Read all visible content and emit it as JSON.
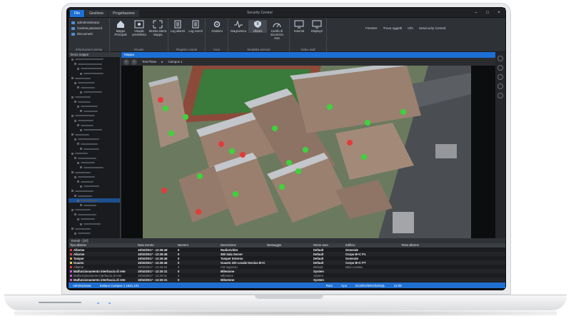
{
  "window": {
    "title": "Security Central",
    "tabs": [
      {
        "label": "File",
        "active": true
      },
      {
        "label": "Gestione",
        "active": false
      },
      {
        "label": "Progettazione",
        "active": false
      }
    ],
    "top_menu": [
      "Finestre",
      "Trova oggetti",
      "Info",
      "Sesecurity Central"
    ]
  },
  "ribbon": {
    "account_items": [
      "admdministrator",
      "Cambia password",
      "Disconnetti"
    ],
    "account_group_label": "Informazioni utente",
    "visuals_group": {
      "label": "Visuale",
      "buttons": [
        "Mappe Principali",
        "Visuale predefinita",
        "Mostra intera mappa"
      ]
    },
    "log_group": {
      "label": "Registro eventi",
      "buttons": [
        "Log allarmi",
        "Log eventi"
      ]
    },
    "area_group": {
      "label": "Aree",
      "buttons": [
        "Gestioni"
      ]
    },
    "sensor_group": {
      "label": "Modalità sensori",
      "buttons": [
        "Diagnostica",
        "Allarmi",
        "Livello di sicurezza Oss"
      ]
    },
    "video_group": {
      "label": "Video wall",
      "buttons": [
        "Internal",
        "Display2"
      ]
    }
  },
  "left_panel": {
    "title": "lenco mappe"
  },
  "map": {
    "panel_title": "Mappa",
    "breadcrumb": [
      "Test Plans",
      "Campus 1"
    ]
  },
  "alarms": {
    "panel_title": "Eventi - [37]",
    "columns": [
      "Tipo allarme",
      "Data evento",
      "Numero",
      "Descrizione",
      "Messaggio",
      "Nome area",
      "Edificio",
      "Testo allarme"
    ],
    "rows": [
      {
        "type": "Allarme",
        "date": "19/10/2017 - 12:26:49",
        "number": "0",
        "desc": "Radiorivlder",
        "msg": "",
        "area": "Default",
        "building": "Generale",
        "text": "",
        "severity": "#e23b3b",
        "style": "bold"
      },
      {
        "type": "Allarme",
        "date": "19/10/2017 - 12:26:48",
        "number": "0",
        "desc": "360 Sala Server",
        "msg": "",
        "area": "Default",
        "building": "Corpo B+C P1",
        "text": "",
        "severity": "#e23b3b",
        "style": "bold"
      },
      {
        "type": "Tamper",
        "date": "19/10/2017 - 12:26:48",
        "number": "0",
        "desc": "Tamper Esterno",
        "msg": "",
        "area": "Default",
        "building": "Generale",
        "text": "",
        "severity": "#e8a23b",
        "style": "bold"
      },
      {
        "type": "Guasto",
        "date": "19/10/2017 - 12:26:46",
        "number": "0",
        "desc": "Guasto 220 Locale tecnico B+C",
        "msg": "",
        "area": "Default",
        "building": "Corpo B+C PT",
        "text": "",
        "severity": "#e8d23b",
        "style": "bold"
      },
      {
        "type": "Allarme",
        "date": "19/10/2017 - 12:26:43",
        "number": "0",
        "desc": "CM Ingresso",
        "msg": "",
        "area": "Default",
        "building": "Istbc Levetta",
        "text": "",
        "severity": "#e23b3b",
        "style": "dim"
      },
      {
        "type": "Malfunzionamento interfaccia di rete",
        "date": "19/10/2017 - 12:20:31",
        "number": "0",
        "desc": "Milestone",
        "msg": "",
        "area": "System",
        "building": "",
        "text": "",
        "severity": "#c95ad6",
        "style": "bold"
      },
      {
        "type": "Malfunzionamento interfaccia di rete",
        "date": "19/10/2017 - 12:20:31",
        "number": "0",
        "desc": "Milestone",
        "msg": "",
        "area": "System",
        "building": "",
        "text": "",
        "severity": "#c95ad6",
        "style": "dim"
      },
      {
        "type": "Malfunzionamento interfaccia di rete",
        "date": "19/10/2017 - 12:20:31",
        "number": "0",
        "desc": "Milestone",
        "msg": "",
        "area": "System",
        "building": "",
        "text": "",
        "severity": "#c95ad6",
        "style": "bold"
      }
    ]
  },
  "statusbar": {
    "user": "Administrator",
    "info": "Italiano   Campus 1   1621,101",
    "ram": "Ram",
    "cpu": "Cpu",
    "server": "ECSRV/SRV/SOSQL",
    "time": "12:05"
  },
  "colors": {
    "accent": "#1c6fd6",
    "alarm_red": "#e23b3b",
    "sensor_green": "#3cd43c"
  }
}
